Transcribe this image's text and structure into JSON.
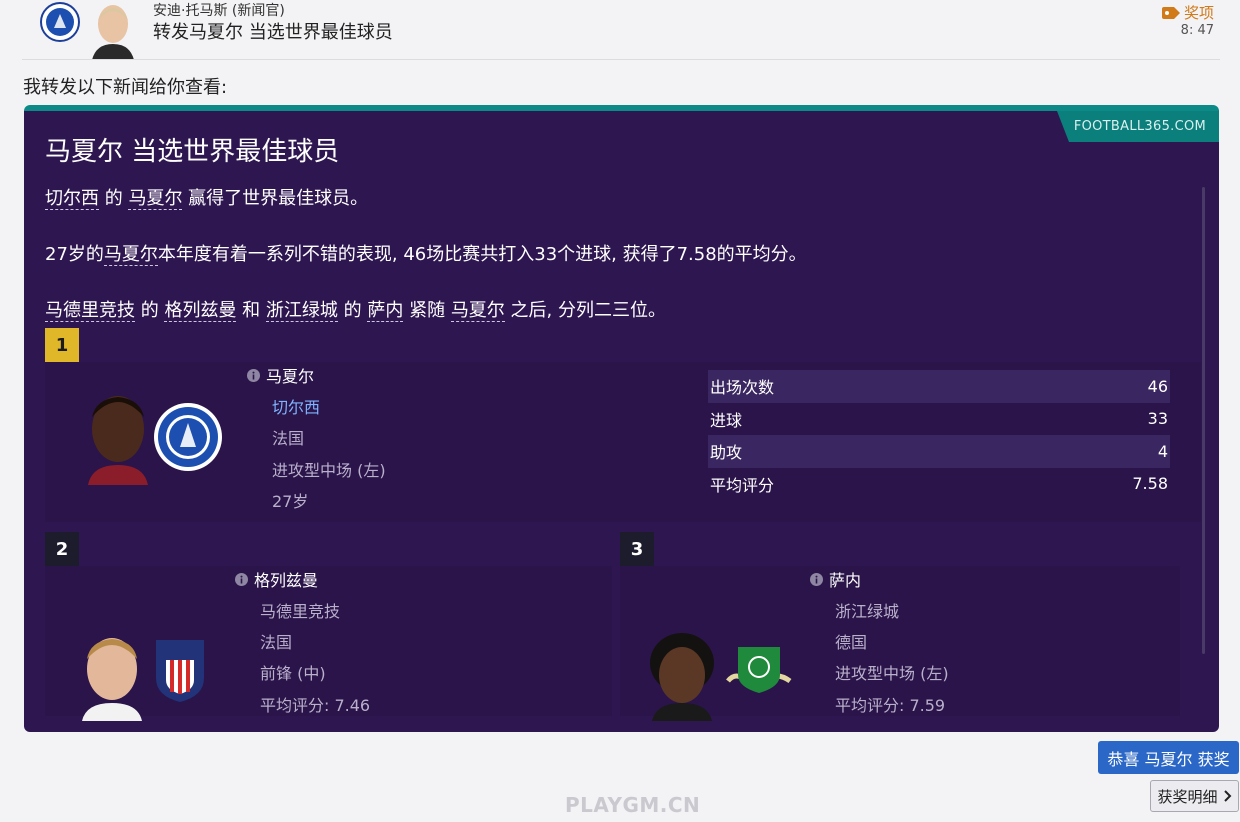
{
  "header": {
    "sender": "安迪·托马斯 (新闻官)",
    "subject": "转发马夏尔 当选世界最佳球员",
    "tag": "奖项",
    "time": "8: 47"
  },
  "intro": "我转发以下新闻给你查看:",
  "news": {
    "source": "FOOTBALL365.COM",
    "title": "马夏尔 当选世界最佳球员",
    "p1": {
      "club": "切尔西",
      "de": " 的 ",
      "player": "马夏尔",
      "rest": " 赢得了世界最佳球员。"
    },
    "p2": {
      "pre": "27岁的",
      "player": "马夏尔",
      "rest": "本年度有着一系列不错的表现, 46场比赛共打入33个进球, 获得了7.58的平均分。"
    },
    "p3": {
      "club2": "马德里竞技",
      "de1": " 的 ",
      "player2": "格列兹曼",
      "he": " 和 ",
      "club3": "浙江绿城",
      "de2": " 的 ",
      "player3": "萨内",
      "follow": " 紧随 ",
      "player1": "马夏尔",
      "rest": " 之后, 分列二三位。"
    }
  },
  "winners": [
    {
      "rank": "1",
      "name": "马夏尔",
      "club": "切尔西",
      "nation": "法国",
      "position": "进攻型中场 (左)",
      "age": "27岁",
      "stats": [
        {
          "label": "出场次数",
          "value": "46"
        },
        {
          "label": "进球",
          "value": "33"
        },
        {
          "label": "助攻",
          "value": "4"
        },
        {
          "label": "平均评分",
          "value": "7.58"
        }
      ]
    },
    {
      "rank": "2",
      "name": "格列兹曼",
      "club": "马德里竞技",
      "nation": "法国",
      "position": "前锋 (中)",
      "rating": "平均评分: 7.46"
    },
    {
      "rank": "3",
      "name": "萨内",
      "club": "浙江绿城",
      "nation": "德国",
      "position": "进攻型中场 (左)",
      "rating": "平均评分: 7.59"
    }
  ],
  "actions": {
    "congrats": "恭喜 马夏尔 获奖",
    "details": "获奖明细"
  },
  "watermark": "PLAYGM.CN",
  "colors": {
    "card_bg": "#2e1650",
    "accent_teal": "#0b8a87",
    "rank1_gold": "#e1b72a",
    "primary_button": "#2b67c6",
    "link_blue": "#7fb3ff",
    "tag_orange": "#d07a1a"
  },
  "icons": [
    "chelsea-crest-icon",
    "award-tag-icon",
    "info-icon",
    "chevron-right-icon",
    "atletico-crest-icon",
    "zhejiang-crest-icon"
  ]
}
